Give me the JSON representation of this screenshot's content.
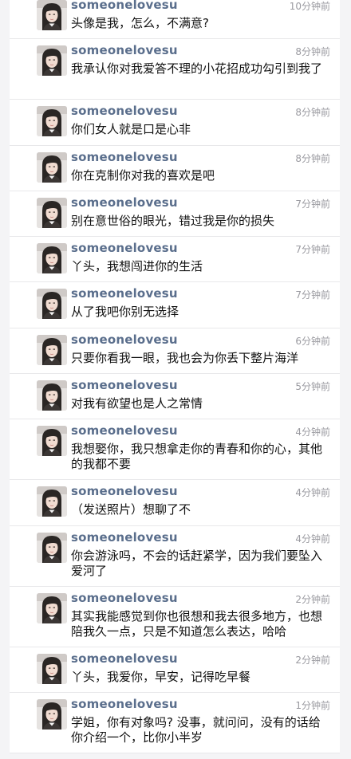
{
  "messages": [
    {
      "username": "someonelovesu",
      "time": "10分钟前",
      "text": "头像是我，怎么，不满意?"
    },
    {
      "username": "someonelovesu",
      "time": "8分钟前",
      "text": "我承认你对我爱答不理的小花招成功勾引到我了"
    },
    {
      "username": "someonelovesu",
      "time": "8分钟前",
      "text": "你们女人就是口是心非"
    },
    {
      "username": "someonelovesu",
      "time": "8分钟前",
      "text": "你在克制你对我的喜欢是吧"
    },
    {
      "username": "someonelovesu",
      "time": "7分钟前",
      "text": "别在意世俗的眼光，错过我是你的损失"
    },
    {
      "username": "someonelovesu",
      "time": "7分钟前",
      "text": "丫头，我想闯进你的生活"
    },
    {
      "username": "someonelovesu",
      "time": "7分钟前",
      "text": "从了我吧你别无选择"
    },
    {
      "username": "someonelovesu",
      "time": "6分钟前",
      "text": "只要你看我一眼，我也会为你丢下整片海洋"
    },
    {
      "username": "someonelovesu",
      "time": "5分钟前",
      "text": "对我有欲望也是人之常情"
    },
    {
      "username": "someonelovesu",
      "time": "4分钟前",
      "text": "我想娶你，我只想拿走你的青春和你的心，其他的我都不要"
    },
    {
      "username": "someonelovesu",
      "time": "4分钟前",
      "text": "（发送照片）想聊了不"
    },
    {
      "username": "someonelovesu",
      "time": "4分钟前",
      "text": "你会游泳吗，不会的话赶紧学，因为我们要坠入爱河了"
    },
    {
      "username": "someonelovesu",
      "time": "2分钟前",
      "text": "其实我能感觉到你也很想和我去很多地方，也想陪我久一点，只是不知道怎么表达，哈哈"
    },
    {
      "username": "someonelovesu",
      "time": "2分钟前",
      "text": "丫头，我爱你，早安，记得吃早餐"
    },
    {
      "username": "someonelovesu",
      "time": "1分钟前",
      "text": "学姐，你有对象吗? 没事，就问问，没有的话给你介绍一个，比你小半岁"
    }
  ],
  "colors": {
    "username": "#5a6e8c",
    "time": "#9a9aa0",
    "text": "#111111",
    "divider": "#e8e8ea",
    "background": "#f4f4f6"
  },
  "icons": {
    "avatar": "user-photo-avatar"
  }
}
